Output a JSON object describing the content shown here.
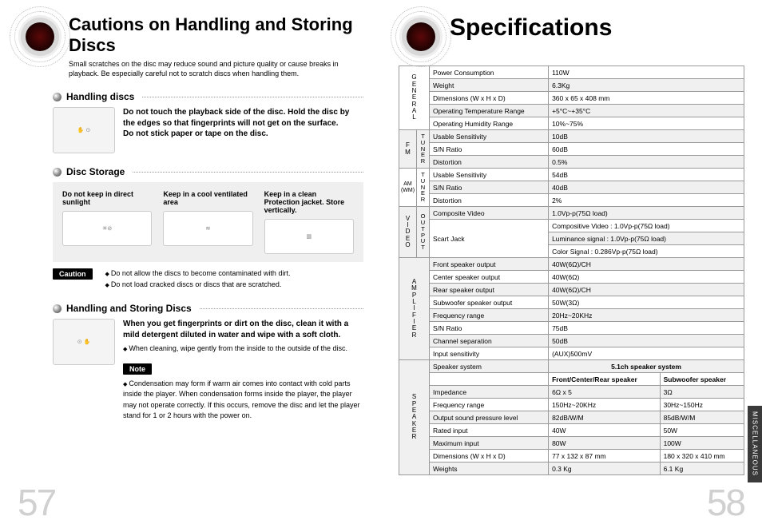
{
  "left": {
    "title": "Cautions on Handling and Storing Discs",
    "intro": "Small scratches on the disc may reduce sound and picture quality or cause breaks in playback. Be especially careful not to scratch discs when handling them.",
    "handling": {
      "heading": "Handling discs",
      "body1": "Do not touch the playback side of the disc. Hold the disc by the edges so that fingerprints will not get on the surface.",
      "body2": "Do not stick paper or tape on the disc."
    },
    "storage": {
      "heading": "Disc Storage",
      "cols": [
        "Do not keep in direct sunlight",
        "Keep in a cool ventilated area",
        "Keep in a clean Protection jacket. Store vertically."
      ],
      "caution_label": "Caution",
      "caution_items": [
        "Do not allow the discs to become contaminated with dirt.",
        "Do not load cracked discs or discs that are scratched."
      ]
    },
    "cleaning": {
      "heading": "Handling and Storing Discs",
      "body1": "When you get fingerprints or dirt on the disc, clean it with a mild detergent diluted in water and wipe with a soft cloth.",
      "body2": "When cleaning, wipe gently from the inside to the outside of the disc.",
      "note_label": "Note",
      "note": "Condensation may form if warm air comes into contact with cold parts inside the player. When condensation forms inside the player, the player may not operate correctly. If this occurs, remove the disc and let the player stand for 1 or 2 hours with the power on."
    },
    "pagenum": "57"
  },
  "right": {
    "title": "Specifications",
    "spec": {
      "groups": {
        "general": "G\nE\nN\nE\nR\nA\nL",
        "fm": "F\nM",
        "am": "AM\n(WM)",
        "tuner": "T\nU\nN\nE\nR",
        "video": "V\nI\nD\nE\nO",
        "output": "O\nU\nT\nP\nU\nT",
        "amp": "A\nM\nP\nL\nI\nF\nI\nE\nR",
        "speaker": "S\nP\nE\nA\nK\nE\nR"
      },
      "general": [
        [
          "Power Consumption",
          "110W"
        ],
        [
          "Weight",
          "6.3Kg"
        ],
        [
          "Dimensions (W x H x D)",
          "360 x 65 x 408 mm"
        ],
        [
          "Operating Temperature Range",
          "+5°C~+35°C"
        ],
        [
          "Operating Humidity Range",
          "10%~75%"
        ]
      ],
      "fm": [
        [
          "Usable Sensitivity",
          "10dB"
        ],
        [
          "S/N Ratio",
          "60dB"
        ],
        [
          "Distortion",
          "0.5%"
        ]
      ],
      "am": [
        [
          "Usable Sensitivity",
          "54dB"
        ],
        [
          "S/N Ratio",
          "40dB"
        ],
        [
          "Distortion",
          "2%"
        ]
      ],
      "video": {
        "composite": [
          "Composite Video",
          "1.0Vp-p(75Ω load)"
        ],
        "scart_label": "Scart Jack",
        "scart_rows": [
          "Compositive Video : 1.0Vp-p(75Ω load)",
          "Luminance signal : 1.0Vp-p(75Ω load)",
          "Color Signal : 0.286Vp-p(75Ω load)"
        ]
      },
      "amp": [
        [
          "Front speaker output",
          "40W(6Ω)/CH"
        ],
        [
          "Center speaker output",
          "40W(6Ω)"
        ],
        [
          "Rear speaker output",
          "40W(6Ω)/CH"
        ],
        [
          "Subwoofer speaker output",
          "50W(3Ω)"
        ],
        [
          "Frequency range",
          "20Hz~20KHz"
        ],
        [
          "S/N Ratio",
          "75dB"
        ],
        [
          "Channel separation",
          "50dB"
        ],
        [
          "Input sensitivity",
          "(AUX)500mV"
        ]
      ],
      "speaker": {
        "system_row": [
          "Speaker system",
          "5.1ch speaker system"
        ],
        "cols": [
          "Front/Center/Rear speaker",
          "Subwoofer speaker"
        ],
        "rows": [
          [
            "Impedance",
            "6Ω x 5",
            "3Ω"
          ],
          [
            "Frequency range",
            "150Hz~20KHz",
            "30Hz~150Hz"
          ],
          [
            "Output sound pressure level",
            "82dB/W/M",
            "85dB/W/M"
          ],
          [
            "Rated input",
            "40W",
            "50W"
          ],
          [
            "Maximum input",
            "80W",
            "100W"
          ],
          [
            "Dimensions  (W x H x D)",
            "77 x 132 x 87 mm",
            "180 x 320 x 410 mm"
          ],
          [
            "Weights",
            "0.3 Kg",
            "6.1 Kg"
          ]
        ]
      }
    },
    "sidetab": "MISCELLANEOUS",
    "pagenum": "58"
  }
}
